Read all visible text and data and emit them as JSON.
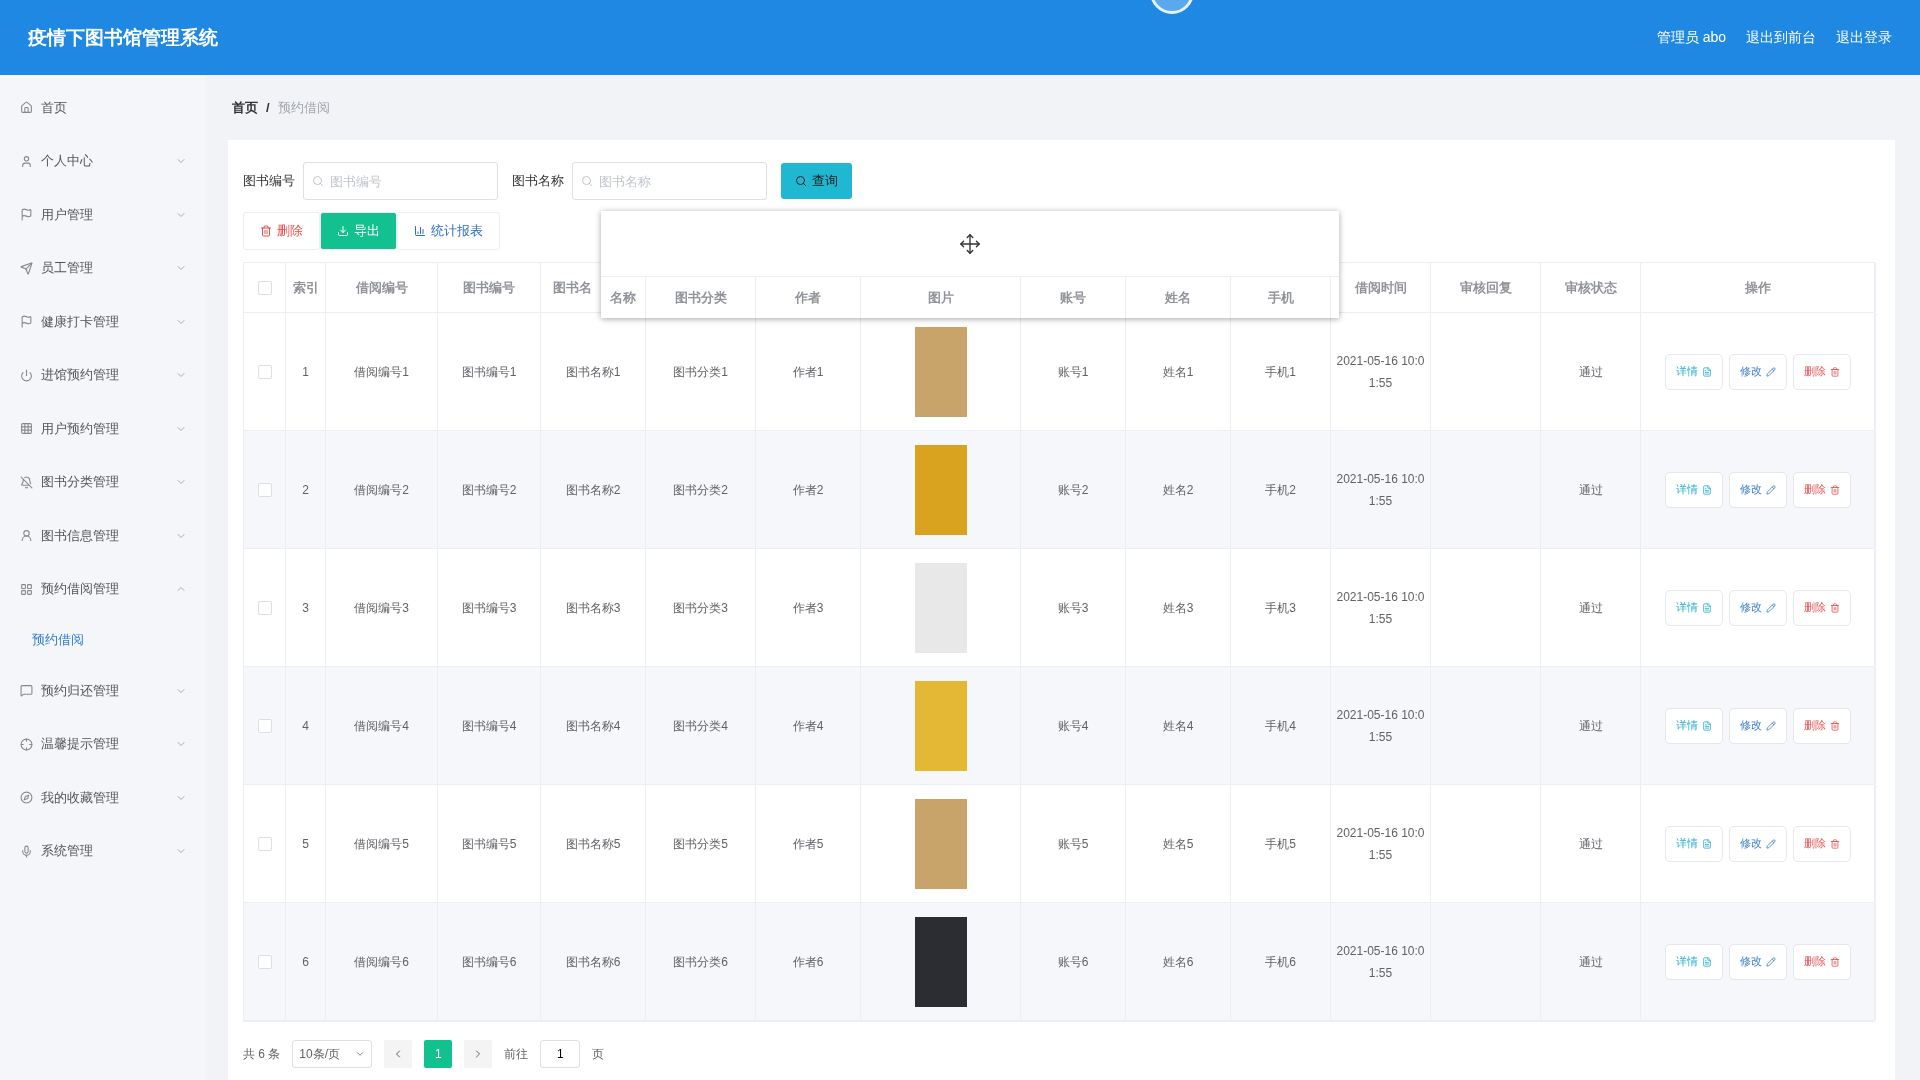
{
  "header": {
    "title": "疫情下图书馆管理系统",
    "user": "管理员 abo",
    "links": [
      "退出到前台",
      "退出登录"
    ]
  },
  "sidebar": {
    "items": [
      {
        "label": "首页",
        "kind": "link"
      },
      {
        "label": "个人中心",
        "kind": "group",
        "expanded": false
      },
      {
        "label": "用户管理",
        "kind": "group",
        "expanded": false
      },
      {
        "label": "员工管理",
        "kind": "group",
        "expanded": false
      },
      {
        "label": "健康打卡管理",
        "kind": "group",
        "expanded": false
      },
      {
        "label": "进馆预约管理",
        "kind": "group",
        "expanded": false
      },
      {
        "label": "用户预约管理",
        "kind": "group",
        "expanded": false
      },
      {
        "label": "图书分类管理",
        "kind": "group",
        "expanded": false
      },
      {
        "label": "图书信息管理",
        "kind": "group",
        "expanded": false
      },
      {
        "label": "预约借阅管理",
        "kind": "group",
        "expanded": true,
        "children": [
          {
            "label": "预约借阅",
            "selected": true
          }
        ]
      },
      {
        "label": "预约归还管理",
        "kind": "group",
        "expanded": false
      },
      {
        "label": "温馨提示管理",
        "kind": "group",
        "expanded": false
      },
      {
        "label": "我的收藏管理",
        "kind": "group",
        "expanded": false
      },
      {
        "label": "系统管理",
        "kind": "group",
        "expanded": false
      }
    ]
  },
  "breadcrumb": [
    "首页",
    "/",
    "预约借阅"
  ],
  "search": {
    "fields": [
      {
        "label": "图书编号",
        "placeholder": "图书编号"
      },
      {
        "label": "图书名称",
        "placeholder": "图书名称"
      }
    ],
    "button": "查询"
  },
  "toolbar": [
    {
      "label": "删除",
      "kind": "danger"
    },
    {
      "label": "导出",
      "kind": "primary"
    },
    {
      "label": "统计报表",
      "kind": "plain"
    }
  ],
  "table": {
    "all_selected": false,
    "columns_left": [
      "索引",
      "借阅编号",
      "图书编号",
      "图书名"
    ],
    "columns_right": [
      "借阅时间",
      "审核回复",
      "审核状态",
      "操作"
    ],
    "rows": [
      {
        "selected": false,
        "index": "1",
        "borrow_no": "借阅编号1",
        "book_no": "图书编号1",
        "book_name": "图书名称1",
        "category": "图书分类1",
        "author": "作者1",
        "account": "账号1",
        "name": "姓名1",
        "phone": "手机1",
        "borrow_time": "2021-05-16 10:01:55",
        "status": "通过",
        "actions": [
          "详情",
          "修改",
          "删除"
        ]
      },
      {
        "selected": false,
        "index": "2",
        "borrow_no": "借阅编号2",
        "book_no": "图书编号2",
        "book_name": "图书名称2",
        "category": "图书分类2",
        "author": "作者2",
        "account": "账号2",
        "name": "姓名2",
        "phone": "手机2",
        "borrow_time": "2021-05-16 10:01:55",
        "status": "通过",
        "actions": [
          "详情",
          "修改",
          "删除"
        ]
      },
      {
        "selected": false,
        "index": "3",
        "borrow_no": "借阅编号3",
        "book_no": "图书编号3",
        "book_name": "图书名称3",
        "category": "图书分类3",
        "author": "作者3",
        "account": "账号3",
        "name": "姓名3",
        "phone": "手机3",
        "borrow_time": "2021-05-16 10:01:55",
        "status": "通过",
        "actions": [
          "详情",
          "修改",
          "删除"
        ]
      },
      {
        "selected": false,
        "index": "4",
        "borrow_no": "借阅编号4",
        "book_no": "图书编号4",
        "book_name": "图书名称4",
        "category": "图书分类4",
        "author": "作者4",
        "account": "账号4",
        "name": "姓名4",
        "phone": "手机4",
        "borrow_time": "2021-05-16 10:01:55",
        "status": "通过",
        "actions": [
          "详情",
          "修改",
          "删除"
        ]
      },
      {
        "selected": false,
        "index": "5",
        "borrow_no": "借阅编号5",
        "book_no": "图书编号5",
        "book_name": "图书名称5",
        "category": "图书分类5",
        "author": "作者5",
        "account": "账号5",
        "name": "姓名5",
        "phone": "手机5",
        "borrow_time": "2021-05-16 10:01:55",
        "status": "通过",
        "actions": [
          "详情",
          "修改",
          "删除"
        ]
      },
      {
        "selected": false,
        "index": "6",
        "borrow_no": "借阅编号6",
        "book_no": "图书编号6",
        "book_name": "图书名称6",
        "category": "图书分类6",
        "author": "作者6",
        "account": "账号6",
        "name": "姓名6",
        "phone": "手机6",
        "borrow_time": "2021-05-16 10:01:55",
        "status": "通过",
        "actions": [
          "详情",
          "修改",
          "删除"
        ]
      }
    ]
  },
  "dragged_header": {
    "columns": [
      "名称",
      "图书分类",
      "作者",
      "图片",
      "账号",
      "姓名",
      "手机"
    ]
  },
  "pagination": {
    "total": "共 6 条",
    "page_size": "10条/页",
    "pages": [
      {
        "label": "1",
        "selected": true
      }
    ],
    "goto_label": "前往",
    "goto_value": "1",
    "goto_suffix": "页"
  }
}
